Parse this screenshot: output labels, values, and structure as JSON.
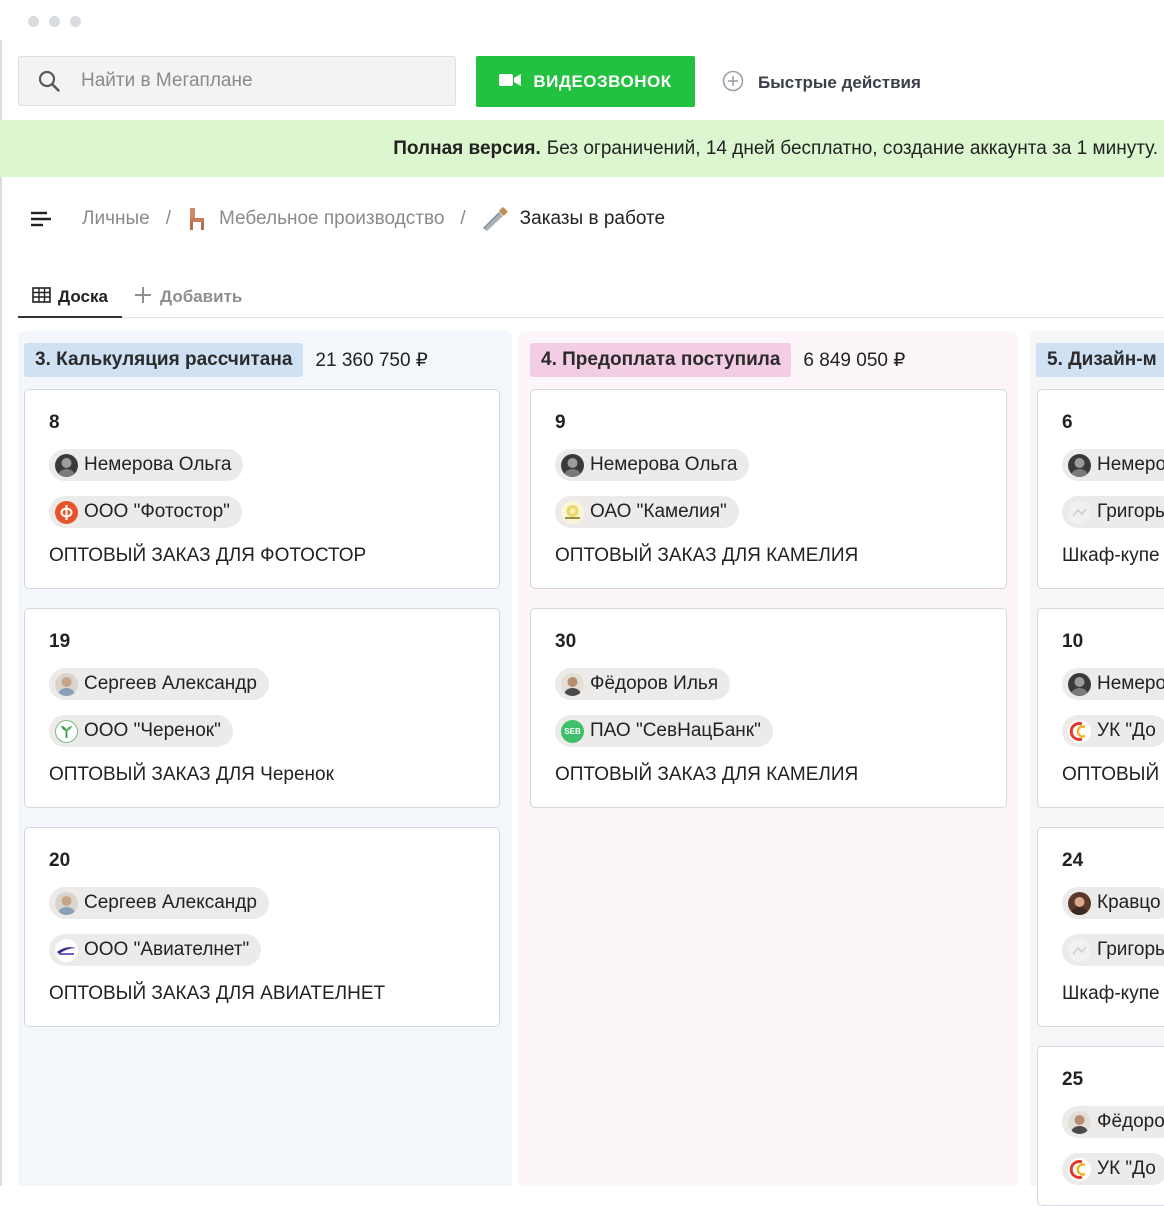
{
  "search": {
    "placeholder": "Найти в Мегаплане"
  },
  "toolbar": {
    "video_label": "ВИДЕОЗВОНОК",
    "quick_label": "Быстрые действия"
  },
  "promo": {
    "bold": "Полная версия.",
    "text": "Без ограничений, 14 дней бесплатно, создание аккаунта за 1 минуту."
  },
  "breadcrumbs": {
    "items": [
      "Личные",
      "Мебельное производство",
      "Заказы в работе"
    ],
    "separator": "/"
  },
  "tabs": {
    "board": "Доска",
    "add": "Добавить"
  },
  "colors": {
    "accent_green": "#22c140",
    "promo_bg": "#dcf6cf",
    "stage_blue": "#cfe1f2",
    "stage_pink": "#f2cde3"
  },
  "columns": [
    {
      "name": "3. Калькуляция рассчитана",
      "sum": "21 360 750 ₽",
      "cards": [
        {
          "num": "8",
          "person": "Немерова Ольга",
          "company": "ООО \"Фотостор\"",
          "title": "ОПТОВЫЙ ЗАКАЗ ДЛЯ ФОТОСТОР"
        },
        {
          "num": "19",
          "person": "Сергеев Александр",
          "company": "ООО \"Черенок\"",
          "title": "ОПТОВЫЙ ЗАКАЗ ДЛЯ Черенок"
        },
        {
          "num": "20",
          "person": "Сергеев Александр",
          "company": "ООО \"Авиателнет\"",
          "title": "ОПТОВЫЙ ЗАКАЗ ДЛЯ АВИАТЕЛНЕТ"
        }
      ]
    },
    {
      "name": "4. Предоплата поступила",
      "sum": "6 849 050 ₽",
      "cards": [
        {
          "num": "9",
          "person": "Немерова Ольга",
          "company": "ОАО \"Камелия\"",
          "title": "ОПТОВЫЙ ЗАКАЗ ДЛЯ КАМЕЛИЯ"
        },
        {
          "num": "30",
          "person": "Фёдоров Илья",
          "company": "ПАО \"СевНацБанк\"",
          "title": "ОПТОВЫЙ ЗАКАЗ ДЛЯ КАМЕЛИЯ"
        }
      ]
    },
    {
      "name": "5. Дизайн-м",
      "cards": [
        {
          "num": "6",
          "person": "Немеро",
          "company": "Григорь",
          "title": "Шкаф-купе"
        },
        {
          "num": "10",
          "person": "Немеро",
          "company": "УК \"До",
          "title": "ОПТОВЫЙ"
        },
        {
          "num": "24",
          "person": "Кравцо",
          "company": "Григорь",
          "title": "Шкаф-купе"
        },
        {
          "num": "25",
          "person": "Фёдоро",
          "company": "УК \"До"
        }
      ]
    }
  ],
  "logos": {
    "sevnacbank": "SEB"
  }
}
